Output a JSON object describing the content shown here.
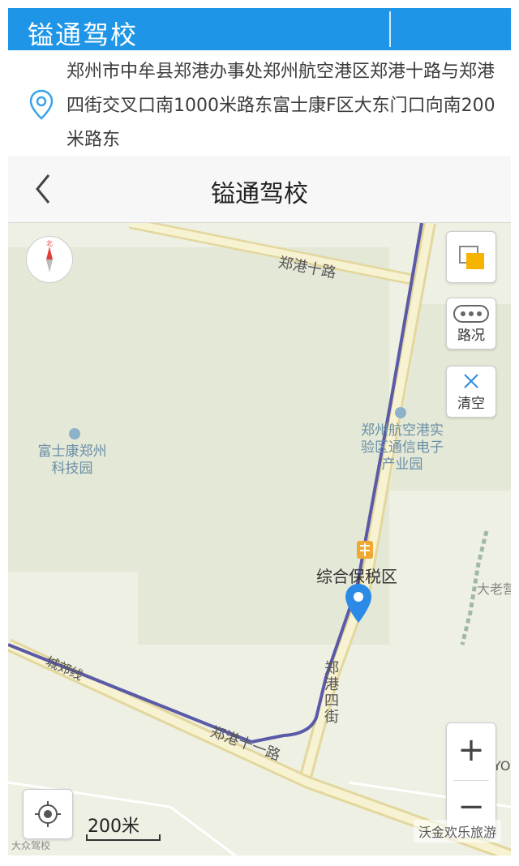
{
  "header": {
    "title": "镒通驾校"
  },
  "address": {
    "text": "郑州市中牟县郑港办事处郑州航空港区郑港十路与郑港四街交叉口南1000米路东富士康F区大东门口向南200米路东"
  },
  "navbar": {
    "title": "镒通驾校"
  },
  "map": {
    "roads": {
      "road_north": "郑港十路",
      "road_south": "郑港十一路",
      "road_east": "郑港四街",
      "road_diag": "城郊线"
    },
    "pois": {
      "foxconn": "富士康郑州科技园",
      "airport_zone": "郑州航空港实验区通信电子产业园",
      "bonded": "综合保税区",
      "edge": "大老营",
      "edge_right": "YO"
    },
    "controls": {
      "traffic_label": "路况",
      "clear_label": "清空",
      "compass_north": "北",
      "zoom_in": "+",
      "zoom_out": "−"
    },
    "scale_label": "200米",
    "watermark": "沃金欢乐旅游",
    "watermark_left": "大众驾校"
  },
  "colors": {
    "accent": "#1e95e6",
    "pin": "#2a8ae6",
    "road_edge": "#d8c98a",
    "rail": "#5a5aa8"
  }
}
